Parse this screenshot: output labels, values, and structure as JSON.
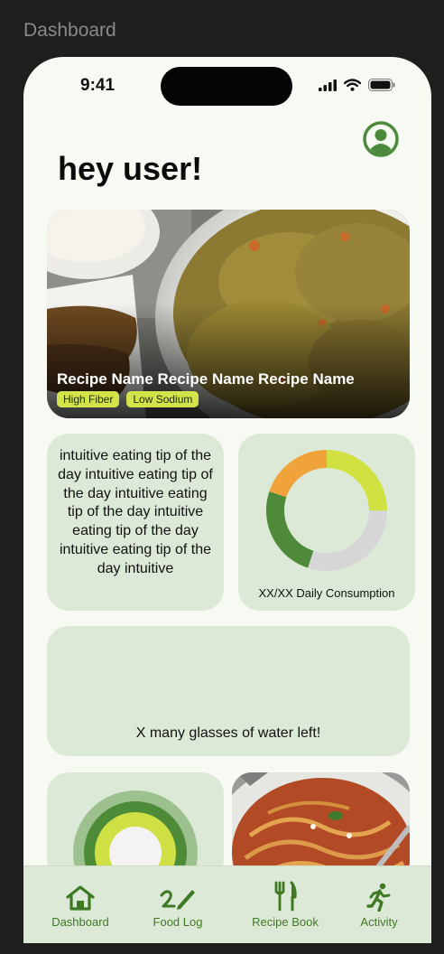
{
  "frame_label": "Dashboard",
  "status": {
    "time": "9:41"
  },
  "greeting": "hey user!",
  "hero": {
    "name": "Recipe Name Recipe Name Recipe Name",
    "tags": [
      "High Fiber",
      "Low Sodium"
    ]
  },
  "tip": {
    "text": "intuitive eating tip of the day intuitive eating tip of the day intuitive eating tip of the day intuitive eating tip of the day intuitive eating tip of the day intuitive"
  },
  "consumption": {
    "caption": "XX/XX Daily Consumption",
    "segments": [
      {
        "value": 0.25,
        "color": "#d1e141"
      },
      {
        "value": 0.3,
        "color": "#d6d6d6"
      },
      {
        "value": 0.25,
        "color": "#4f8a3a"
      },
      {
        "value": 0.2,
        "color": "#f1a33b"
      }
    ]
  },
  "water": {
    "text": "X many glasses of water left!"
  },
  "tabs": [
    {
      "label": "Dashboard",
      "icon": "home-icon"
    },
    {
      "label": "Food Log",
      "icon": "pencil-icon"
    },
    {
      "label": "Recipe Book",
      "icon": "fork-knife-icon"
    },
    {
      "label": "Activity",
      "icon": "running-icon"
    }
  ],
  "colors": {
    "accent": "#3e7a24",
    "card": "#dde9d7",
    "background": "#f6faf2",
    "tag": "#d2e44a"
  }
}
